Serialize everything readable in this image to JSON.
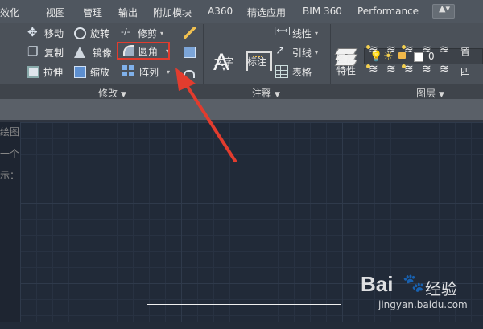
{
  "tabs": [
    "效化",
    "视图",
    "管理",
    "输出",
    "附加模块",
    "A360",
    "精选应用",
    "BIM 360",
    "Performance"
  ],
  "tabbar_button": "▲▾",
  "modify_panel": {
    "title": "修改",
    "tools": {
      "move": "移动",
      "rotate": "旋转",
      "trim": "修剪",
      "copy": "复制",
      "mirror": "镜像",
      "fillet": "圆角",
      "stretch": "拉伸",
      "scale": "缩放",
      "array": "阵列"
    },
    "icons": [
      "move-icon",
      "rotate-icon",
      "trim-icon",
      "brush-icon",
      "copy-icon",
      "mirror-icon",
      "fillet-icon",
      "cube-icon",
      "stretch-icon",
      "scale-icon",
      "array-icon",
      "offset-icon"
    ]
  },
  "annotation_panel": {
    "title": "注释",
    "text_label": "文字",
    "dimension_label": "标注",
    "linear": "线性",
    "leader": "引线",
    "table": "表格"
  },
  "layers_panel": {
    "title": "图层",
    "properties_label": "图层\n特性",
    "current_layer": "0",
    "set_label": "置",
    "four_label": "四"
  },
  "bg_text": [
    "绘图",
    "一个",
    "示："
  ],
  "watermark": {
    "brand": "Bai",
    "paw": "🐾",
    "cn": "经验",
    "url": "jingyan.baidu.com"
  },
  "colors": {
    "highlight": "#e23c2e",
    "canvas": "#212a38",
    "ribbon": "#4b5159"
  }
}
